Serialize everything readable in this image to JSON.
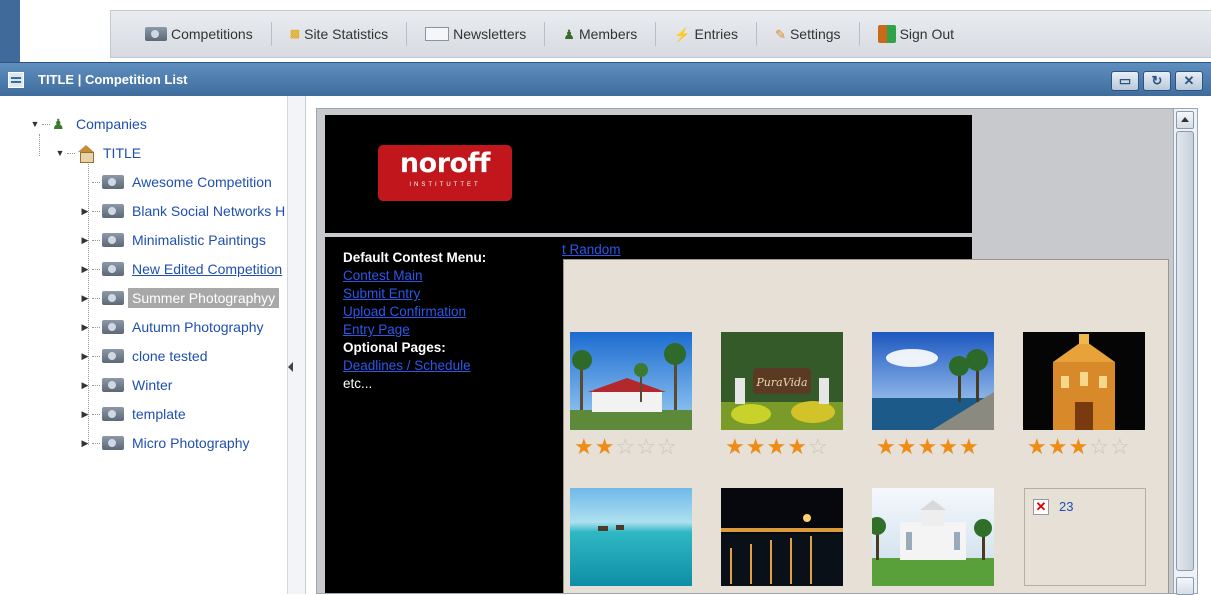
{
  "nav": {
    "items": [
      {
        "label": "Competitions",
        "icon": "competitions-icon"
      },
      {
        "label": "Site Statistics",
        "icon": "chart-icon"
      },
      {
        "label": "Newsletters",
        "icon": "newsletter-icon"
      },
      {
        "label": "Members",
        "icon": "members-icon"
      },
      {
        "label": "Entries",
        "icon": "entries-icon"
      },
      {
        "label": "Settings",
        "icon": "settings-icon"
      },
      {
        "label": "Sign Out",
        "icon": "sign-out-icon"
      }
    ]
  },
  "window": {
    "title": "TITLE | Competition List",
    "buttons": [
      "restore",
      "refresh",
      "close"
    ]
  },
  "tree": {
    "root": "Companies",
    "company": "TITLE",
    "competitions": [
      "Awesome Competition",
      "Blank Social Networks H",
      "Minimalistic Paintings",
      "New Edited Competition",
      "Summer Photographyy",
      "Autumn Photography",
      "clone tested",
      "Winter",
      "template",
      "Micro Photography"
    ],
    "selected": "Summer Photographyy"
  },
  "page": {
    "logo_text": "noroff",
    "logo_subtext": "INSTITUTTET",
    "menu": {
      "default_heading": "Default Contest Menu:",
      "default_links": [
        "Contest Main",
        "Submit Entry",
        "Upload Confirmation",
        "Entry Page"
      ],
      "optional_heading": "Optional Pages:",
      "optional_links": [
        "Deadlines / Schedule"
      ],
      "etc": "etc..."
    },
    "random_link": "t Random"
  },
  "gallery": {
    "entries": [
      {
        "rating": 2
      },
      {
        "rating": 4
      },
      {
        "rating": 5
      },
      {
        "rating": 3
      },
      {
        "rating": null
      },
      {
        "rating": null
      },
      {
        "rating": null
      }
    ],
    "broken_entry_number": "23"
  }
}
